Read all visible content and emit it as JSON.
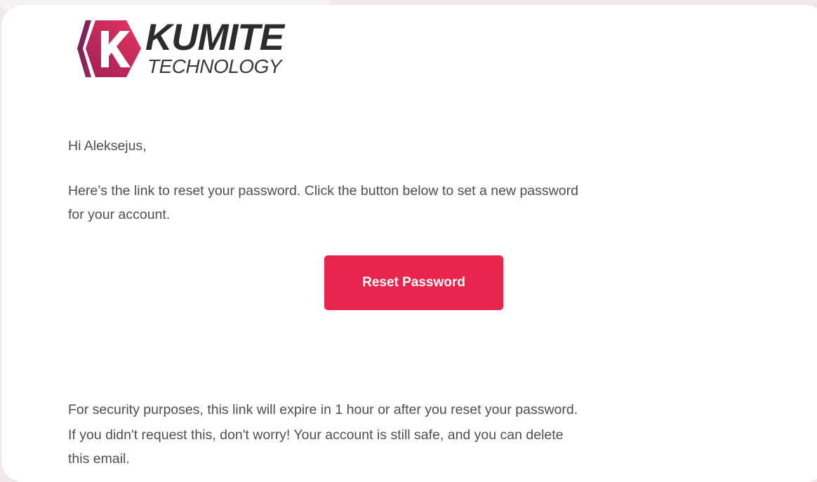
{
  "brand": {
    "name": "KUMITE",
    "tagline": "TECHNOLOGY",
    "colors": {
      "accent": "#e8264d",
      "logo_gradient_start": "#a01f55",
      "logo_gradient_end": "#e5365f",
      "logo_text": "#2c2c2c"
    }
  },
  "email": {
    "greeting": "Hi Aleksejus,",
    "intro_line_1": "Here’s the link to reset your password. Click the button below to set a new password",
    "intro_line_2": "for your account.",
    "reset_button_label": "Reset Password",
    "security_note": "For security purposes, this link will expire in 1 hour or after you reset your password.",
    "reassurance_line_1": "If you didn't request this, don't worry! Your account is still safe, and you can delete",
    "reassurance_line_2": "this email."
  },
  "icons": {
    "logo_mark": "kumite-k-hexagon-icon"
  }
}
